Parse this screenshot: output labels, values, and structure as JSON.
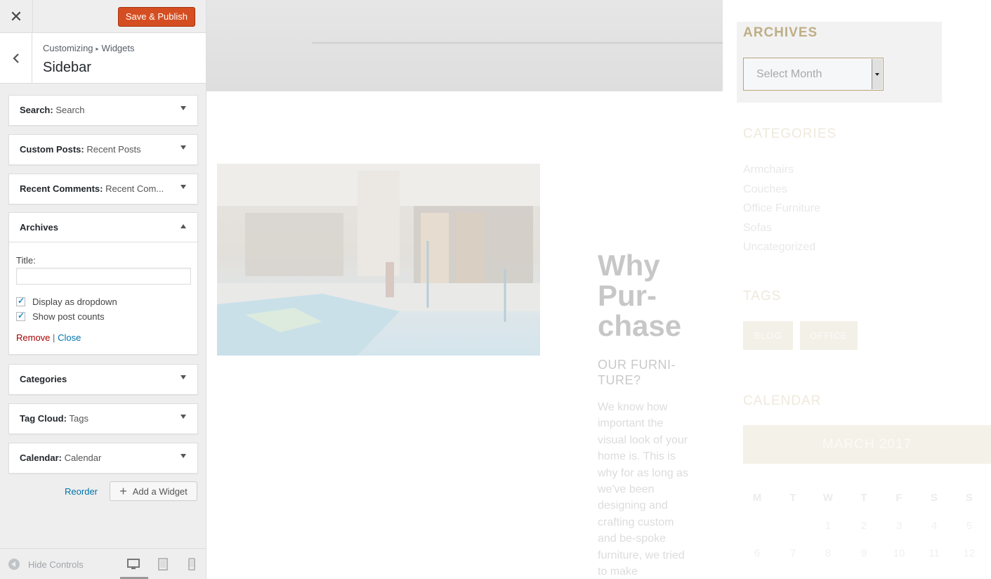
{
  "topbar": {
    "close_icon": "close-icon",
    "save_label": "Save & Publish",
    "save_color": "#d54e21"
  },
  "section": {
    "crumb_root": "Customizing",
    "crumb_child": "Widgets",
    "title": "Sidebar"
  },
  "widgets": [
    {
      "type": "Search",
      "title": "Search"
    },
    {
      "type": "Custom Posts",
      "title": "Recent Posts"
    },
    {
      "type": "Recent Comments",
      "title": "Recent Com..."
    },
    {
      "type": "Archives",
      "title": ""
    },
    {
      "type": "Categories",
      "title": ""
    },
    {
      "type": "Tag Cloud",
      "title": "Tags"
    },
    {
      "type": "Calendar",
      "title": "Calendar"
    }
  ],
  "archives_form": {
    "title_label": "Title:",
    "title_value": "",
    "dropdown_label": "Display as dropdown",
    "dropdown_checked": true,
    "counts_label": "Show post counts",
    "counts_checked": true,
    "remove_label": "Remove",
    "separator": "|",
    "close_label": "Close"
  },
  "actions": {
    "reorder_label": "Reorder",
    "add_widget_label": "Add a Widget"
  },
  "footer": {
    "hide_controls_label": "Hide Controls",
    "devices": [
      "desktop",
      "tablet",
      "mobile"
    ],
    "active_device": "desktop"
  },
  "preview": {
    "why_heading": "Why Pur-chase",
    "why_sub": "OUR FURNI-TURE?",
    "why_body": "We know how important the visual look of your home is. This is why for as long as we've been designing and crafting custom and be-spoke furniture, we tried to make",
    "sidebar": {
      "archives_title": "ARCHIVES",
      "month_select": "Select Month",
      "categories_title": "CATEGORIES",
      "categories": [
        "Armchairs",
        "Couches",
        "Office Furniture",
        "Sofas",
        "Uncategorized"
      ],
      "tags_title": "TAGS",
      "tags": [
        "BLOG",
        "OFFICE"
      ],
      "calendar_title": "CALENDAR",
      "calendar_month": "MARCH 2017",
      "weekdays": [
        "M",
        "T",
        "W",
        "T",
        "F",
        "S",
        "S"
      ],
      "week1": [
        "",
        "",
        "1",
        "2",
        "3",
        "4",
        "5"
      ],
      "week2": [
        "6",
        "7",
        "8",
        "9",
        "10",
        "11",
        "12"
      ]
    }
  }
}
